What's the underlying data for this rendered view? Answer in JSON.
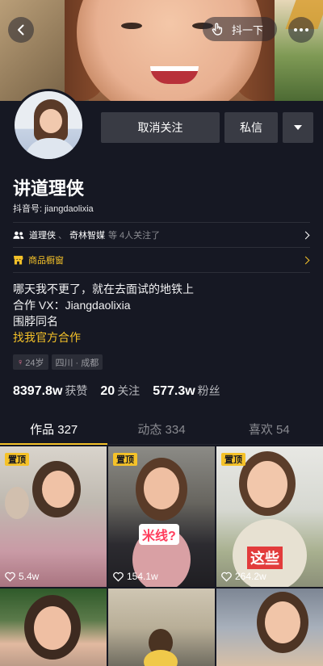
{
  "header": {
    "shake_label": "抖一下"
  },
  "profile": {
    "name": "讲道理侠",
    "uid_label": "抖音号: jiangdaolixia"
  },
  "actions": {
    "unfollow_label": "取消关注",
    "dm_label": "私信"
  },
  "mutual": {
    "names": [
      "道理侠",
      "奇林智媒"
    ],
    "suffix": "等 4人关注了"
  },
  "shop": {
    "label": "商品橱窗"
  },
  "bio": {
    "lines": [
      "哪天我不更了，就在去面试的地铁上",
      "合作 VX：Jiangdaolixia",
      "围脖同名"
    ],
    "link": "找我官方合作"
  },
  "tags": {
    "age": "24岁",
    "location": "四川 · 成都"
  },
  "stats": [
    {
      "value": "8397.8w",
      "label": "获赞"
    },
    {
      "value": "20",
      "label": "关注"
    },
    {
      "value": "577.3w",
      "label": "粉丝"
    }
  ],
  "tabs": [
    {
      "label": "作品 327"
    },
    {
      "label": "动态 334"
    },
    {
      "label": "喜欢 54"
    }
  ],
  "videos": [
    {
      "pinned": "置顶",
      "likes": "5.4w",
      "overlay": ""
    },
    {
      "pinned": "置顶",
      "likes": "154.1w",
      "overlay": "米线?"
    },
    {
      "pinned": "置顶",
      "likes": "264.2w",
      "overlay": "这些"
    }
  ],
  "colors": {
    "background": "#161823",
    "accent": "#f5c229",
    "button": "#393b44"
  }
}
